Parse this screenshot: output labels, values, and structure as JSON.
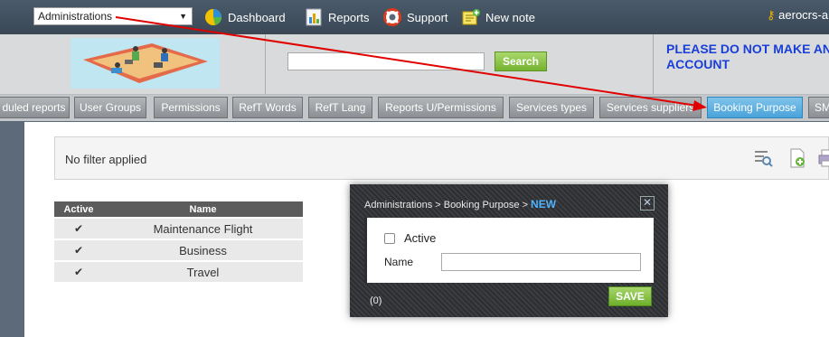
{
  "topbar": {
    "module_select": "Administrations",
    "nav": [
      {
        "label": "Dashboard",
        "icon": "dashboard-pie-icon"
      },
      {
        "label": "Reports",
        "icon": "reports-chart-icon"
      },
      {
        "label": "Support",
        "icon": "support-lifebuoy-icon"
      },
      {
        "label": "New note",
        "icon": "new-note-icon"
      }
    ],
    "user": "aerocrs-a"
  },
  "header": {
    "search_button": "Search",
    "notice_line1": "PLEASE DO NOT MAKE ANY",
    "notice_line2": "ACCOUNT"
  },
  "tabs": [
    "duled reports",
    "User Groups",
    "Permissions",
    "RefT Words",
    "RefT Lang",
    "Reports U/Permissions",
    "Services types",
    "Services suppliers",
    "Booking Purpose",
    "SM"
  ],
  "active_tab_index": 8,
  "filter": {
    "text": "No filter applied",
    "icons": [
      "search-list-icon",
      "add-document-icon",
      "print-icon"
    ]
  },
  "grid": {
    "headers": [
      "Active",
      "Name"
    ],
    "rows": [
      {
        "active": "✔",
        "name": "Maintenance Flight"
      },
      {
        "active": "✔",
        "name": "Business"
      },
      {
        "active": "✔",
        "name": "Travel"
      }
    ]
  },
  "modal": {
    "crumb": "Administrations > Booking Purpose > ",
    "crumb_new": "NEW",
    "active_label": "Active",
    "active_checked": false,
    "name_label": "Name",
    "name_value": "",
    "count": "(0)",
    "save_label": "SAVE"
  },
  "colors": {
    "active_tab": "#4aa3da",
    "search_button": "#76b331",
    "notice_text": "#1a3ed8",
    "annotation_arrow": "#e00000"
  }
}
